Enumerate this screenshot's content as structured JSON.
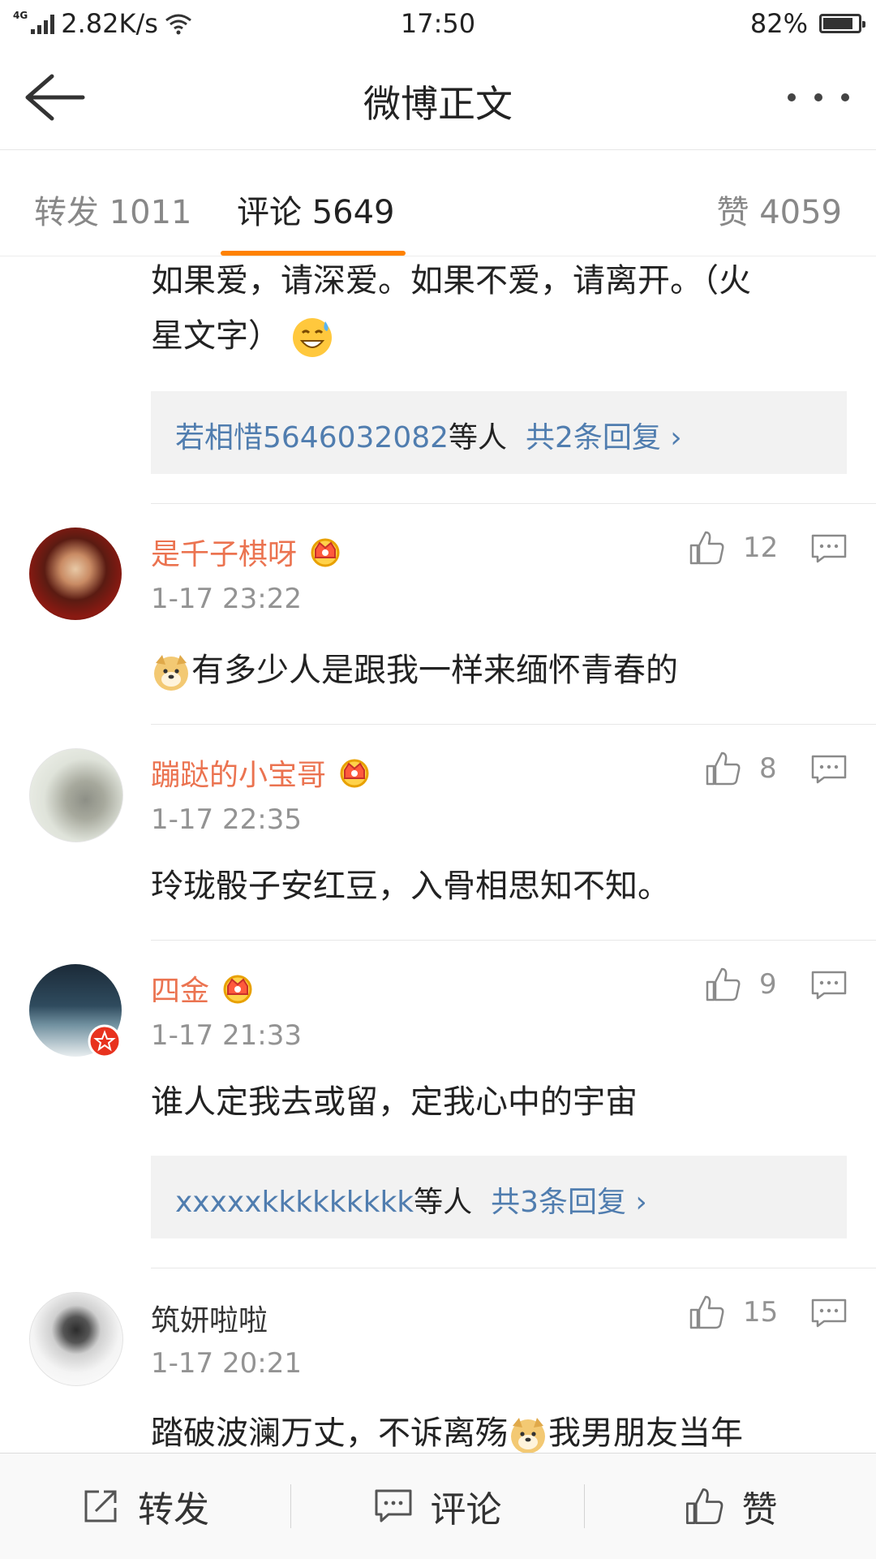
{
  "status_bar": {
    "network_type": "4G",
    "speed": "2.82K/s",
    "time": "17:50",
    "battery_percent": "82%",
    "battery_level": 0.82
  },
  "header": {
    "title": "微博正文"
  },
  "tabs": {
    "repost": "转发 1011",
    "comments": "评论 5649",
    "likes": "赞 4059"
  },
  "comment0": {
    "text_line1": "如果爱，请深爱。如果不爱，请离开。（火",
    "text_line2": "星文字）",
    "reply_users": "若相惜5646032082",
    "reply_suffix": "等人",
    "reply_count": "共2条回复 ›"
  },
  "comments": [
    {
      "username": "是千子棋呀",
      "time": "1-17 23:22",
      "likes": "12",
      "text": "有多少人是跟我一样来缅怀青春的"
    },
    {
      "username": "蹦跶的小宝哥",
      "time": "1-17 22:35",
      "likes": "8",
      "text": "玲珑骰子安红豆，入骨相思知不知。"
    },
    {
      "username": "四金",
      "time": "1-17 21:33",
      "likes": "9",
      "text": "谁人定我去或留，定我心中的宇宙",
      "reply_users": "xxxxxkkkkkkkkk",
      "reply_suffix": "等人",
      "reply_count": "共3条回复 ›"
    },
    {
      "username": "筑妍啦啦",
      "time": "1-17 20:21",
      "likes": "15",
      "text_a": "踏破波澜万丈，不诉离殇",
      "text_b": "我男朋友当年"
    }
  ],
  "bottom_bar": {
    "repost": "转发",
    "comment": "评论",
    "like": "赞"
  },
  "colors": {
    "accent": "#ff8200",
    "username": "#eb7350",
    "link": "#507daf"
  }
}
